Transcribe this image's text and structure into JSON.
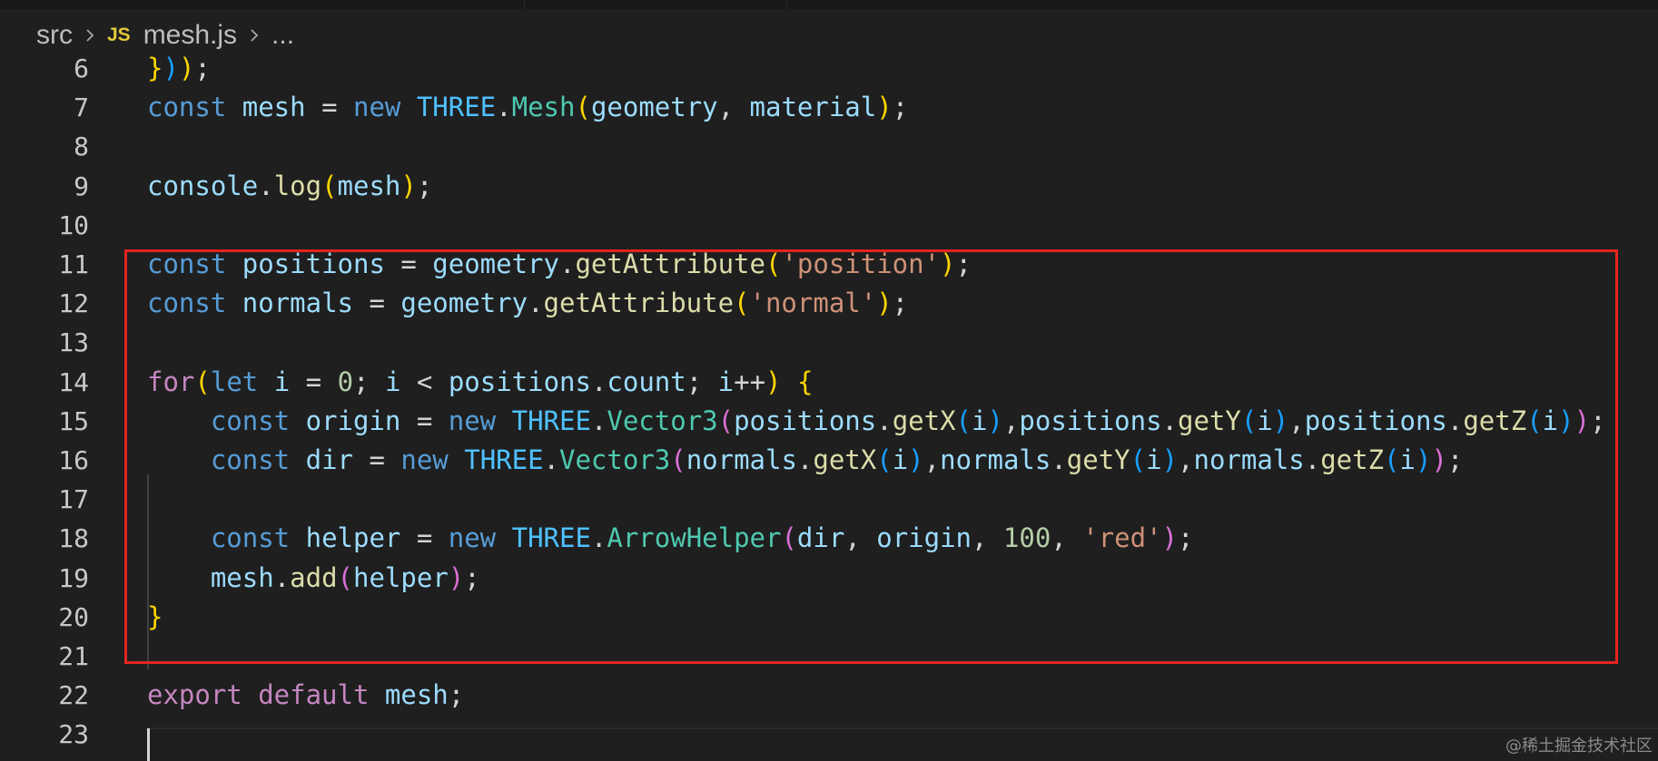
{
  "breadcrumb": {
    "folder": "src",
    "file_icon": "JS",
    "file": "mesh.js",
    "more": "..."
  },
  "editor": {
    "lines": [
      {
        "num": "6",
        "tokens": [
          [
            "b1",
            "}"
          ],
          [
            "b3",
            ")"
          ],
          [
            "b1",
            ")"
          ],
          [
            "t-plain",
            ";"
          ]
        ]
      },
      {
        "num": "7",
        "tokens": [
          [
            "t-kw",
            "const "
          ],
          [
            "t-var",
            "mesh"
          ],
          [
            "t-plain",
            " = "
          ],
          [
            "t-kw",
            "new "
          ],
          [
            "const-th",
            "THREE"
          ],
          [
            "t-plain",
            "."
          ],
          [
            "t-cls",
            "Mesh"
          ],
          [
            "b1",
            "("
          ],
          [
            "t-var",
            "geometry"
          ],
          [
            "t-plain",
            ", "
          ],
          [
            "t-var",
            "material"
          ],
          [
            "b1",
            ")"
          ],
          [
            "t-plain",
            ";"
          ]
        ]
      },
      {
        "num": "8",
        "tokens": []
      },
      {
        "num": "9",
        "tokens": [
          [
            "t-var",
            "console"
          ],
          [
            "t-plain",
            "."
          ],
          [
            "t-fn",
            "log"
          ],
          [
            "b1",
            "("
          ],
          [
            "t-var",
            "mesh"
          ],
          [
            "b1",
            ")"
          ],
          [
            "t-plain",
            ";"
          ]
        ]
      },
      {
        "num": "10",
        "tokens": []
      },
      {
        "num": "11",
        "tokens": [
          [
            "t-kw",
            "const "
          ],
          [
            "t-var",
            "positions"
          ],
          [
            "t-plain",
            " = "
          ],
          [
            "t-var",
            "geometry"
          ],
          [
            "t-plain",
            "."
          ],
          [
            "t-fn",
            "getAttribute"
          ],
          [
            "b1",
            "("
          ],
          [
            "t-str",
            "'position'"
          ],
          [
            "b1",
            ")"
          ],
          [
            "t-plain",
            ";"
          ]
        ]
      },
      {
        "num": "12",
        "tokens": [
          [
            "t-kw",
            "const "
          ],
          [
            "t-var",
            "normals"
          ],
          [
            "t-plain",
            " = "
          ],
          [
            "t-var",
            "geometry"
          ],
          [
            "t-plain",
            "."
          ],
          [
            "t-fn",
            "getAttribute"
          ],
          [
            "b1",
            "("
          ],
          [
            "t-str",
            "'normal'"
          ],
          [
            "b1",
            ")"
          ],
          [
            "t-plain",
            ";"
          ]
        ]
      },
      {
        "num": "13",
        "tokens": []
      },
      {
        "num": "14",
        "tokens": [
          [
            "t-ctl",
            "for"
          ],
          [
            "b1",
            "("
          ],
          [
            "t-kw",
            "let "
          ],
          [
            "t-var",
            "i"
          ],
          [
            "t-plain",
            " = "
          ],
          [
            "t-num",
            "0"
          ],
          [
            "t-plain",
            "; "
          ],
          [
            "t-var",
            "i"
          ],
          [
            "t-plain",
            " < "
          ],
          [
            "t-var",
            "positions"
          ],
          [
            "t-plain",
            "."
          ],
          [
            "t-var",
            "count"
          ],
          [
            "t-plain",
            "; "
          ],
          [
            "t-var",
            "i"
          ],
          [
            "t-plain",
            "++"
          ],
          [
            "b1",
            ")"
          ],
          [
            "t-plain",
            " "
          ],
          [
            "b1",
            "{"
          ]
        ]
      },
      {
        "num": "15",
        "tokens": [
          [
            "t-plain",
            "    "
          ],
          [
            "t-kw",
            "const "
          ],
          [
            "t-var",
            "origin"
          ],
          [
            "t-plain",
            " = "
          ],
          [
            "t-kw",
            "new "
          ],
          [
            "const-th",
            "THREE"
          ],
          [
            "t-plain",
            "."
          ],
          [
            "t-cls",
            "Vector3"
          ],
          [
            "b2",
            "("
          ],
          [
            "t-var",
            "positions"
          ],
          [
            "t-plain",
            "."
          ],
          [
            "t-fn",
            "getX"
          ],
          [
            "b3",
            "("
          ],
          [
            "t-var",
            "i"
          ],
          [
            "b3",
            ")"
          ],
          [
            "t-plain",
            ","
          ],
          [
            "t-var",
            "positions"
          ],
          [
            "t-plain",
            "."
          ],
          [
            "t-fn",
            "getY"
          ],
          [
            "b3",
            "("
          ],
          [
            "t-var",
            "i"
          ],
          [
            "b3",
            ")"
          ],
          [
            "t-plain",
            ","
          ],
          [
            "t-var",
            "positions"
          ],
          [
            "t-plain",
            "."
          ],
          [
            "t-fn",
            "getZ"
          ],
          [
            "b3",
            "("
          ],
          [
            "t-var",
            "i"
          ],
          [
            "b3",
            ")"
          ],
          [
            "b2",
            ")"
          ],
          [
            "t-plain",
            ";"
          ]
        ]
      },
      {
        "num": "16",
        "tokens": [
          [
            "t-plain",
            "    "
          ],
          [
            "t-kw",
            "const "
          ],
          [
            "t-var",
            "dir"
          ],
          [
            "t-plain",
            " = "
          ],
          [
            "t-kw",
            "new "
          ],
          [
            "const-th",
            "THREE"
          ],
          [
            "t-plain",
            "."
          ],
          [
            "t-cls",
            "Vector3"
          ],
          [
            "b2",
            "("
          ],
          [
            "t-var",
            "normals"
          ],
          [
            "t-plain",
            "."
          ],
          [
            "t-fn",
            "getX"
          ],
          [
            "b3",
            "("
          ],
          [
            "t-var",
            "i"
          ],
          [
            "b3",
            ")"
          ],
          [
            "t-plain",
            ","
          ],
          [
            "t-var",
            "normals"
          ],
          [
            "t-plain",
            "."
          ],
          [
            "t-fn",
            "getY"
          ],
          [
            "b3",
            "("
          ],
          [
            "t-var",
            "i"
          ],
          [
            "b3",
            ")"
          ],
          [
            "t-plain",
            ","
          ],
          [
            "t-var",
            "normals"
          ],
          [
            "t-plain",
            "."
          ],
          [
            "t-fn",
            "getZ"
          ],
          [
            "b3",
            "("
          ],
          [
            "t-var",
            "i"
          ],
          [
            "b3",
            ")"
          ],
          [
            "b2",
            ")"
          ],
          [
            "t-plain",
            ";"
          ]
        ]
      },
      {
        "num": "17",
        "tokens": []
      },
      {
        "num": "18",
        "tokens": [
          [
            "t-plain",
            "    "
          ],
          [
            "t-kw",
            "const "
          ],
          [
            "t-var",
            "helper"
          ],
          [
            "t-plain",
            " = "
          ],
          [
            "t-kw",
            "new "
          ],
          [
            "const-th",
            "THREE"
          ],
          [
            "t-plain",
            "."
          ],
          [
            "t-cls",
            "ArrowHelper"
          ],
          [
            "b2",
            "("
          ],
          [
            "t-var",
            "dir"
          ],
          [
            "t-plain",
            ", "
          ],
          [
            "t-var",
            "origin"
          ],
          [
            "t-plain",
            ", "
          ],
          [
            "t-num",
            "100"
          ],
          [
            "t-plain",
            ", "
          ],
          [
            "t-str",
            "'red'"
          ],
          [
            "b2",
            ")"
          ],
          [
            "t-plain",
            ";"
          ]
        ]
      },
      {
        "num": "19",
        "tokens": [
          [
            "t-plain",
            "    "
          ],
          [
            "t-var",
            "mesh"
          ],
          [
            "t-plain",
            "."
          ],
          [
            "t-fn",
            "add"
          ],
          [
            "b2",
            "("
          ],
          [
            "t-var",
            "helper"
          ],
          [
            "b2",
            ")"
          ],
          [
            "t-plain",
            ";"
          ]
        ]
      },
      {
        "num": "20",
        "tokens": [
          [
            "b1",
            "}"
          ]
        ]
      },
      {
        "num": "21",
        "tokens": []
      },
      {
        "num": "22",
        "tokens": [
          [
            "t-ctl",
            "export "
          ],
          [
            "t-ctl",
            "default "
          ],
          [
            "t-var",
            "mesh"
          ],
          [
            "t-plain",
            ";"
          ]
        ]
      },
      {
        "num": "23",
        "tokens": []
      }
    ]
  },
  "watermark": "@稀土掘金技术社区"
}
